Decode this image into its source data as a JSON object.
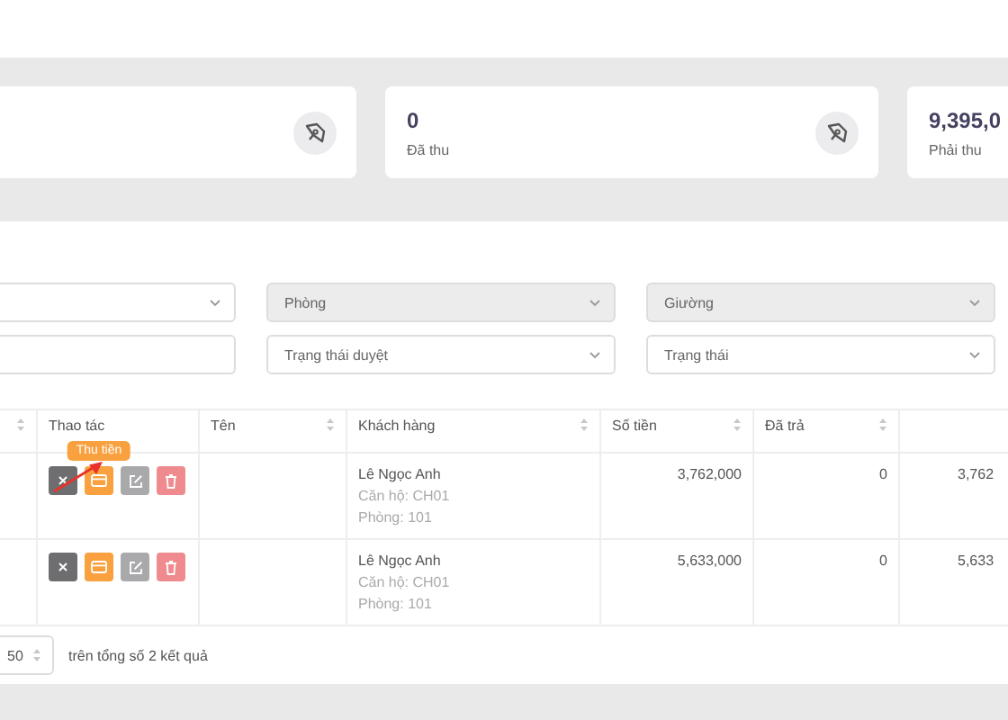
{
  "stats": [
    {
      "icon": true
    },
    {
      "value": "0",
      "label": "Đã thu",
      "icon": true
    },
    {
      "value": "9,395,0",
      "label": "Phải thu",
      "icon": false
    }
  ],
  "filters": [
    {
      "kind": "select",
      "disabled": false
    },
    {
      "kind": "select",
      "placeholder": "Phòng",
      "disabled": true
    },
    {
      "kind": "select",
      "placeholder": "Giường",
      "disabled": true
    },
    {
      "kind": "input",
      "disabled": false
    },
    {
      "kind": "select",
      "placeholder": "Trạng thái duyệt",
      "disabled": false
    },
    {
      "kind": "select",
      "placeholder": "Trạng thái",
      "disabled": false
    }
  ],
  "table": {
    "columns": [
      {
        "kind": "marker",
        "sortable": true
      },
      {
        "kind": "actions",
        "label": "Thao tác",
        "sortable": false
      },
      {
        "kind": "name",
        "label": "Tên",
        "sortable": true
      },
      {
        "kind": "customer",
        "label": "Khách hàng",
        "sortable": true
      },
      {
        "kind": "amount",
        "label": "Số tiền",
        "sortable": true
      },
      {
        "kind": "paid",
        "label": "Đã trả",
        "sortable": true
      },
      {
        "kind": "column_7",
        "sortable": false
      }
    ],
    "rows": [
      {
        "actions": [
          {
            "kind": "cancel"
          },
          {
            "kind": "collect",
            "tooltip": "Thu tiền"
          },
          {
            "kind": "edit"
          },
          {
            "kind": "delete"
          }
        ],
        "customer": {
          "name": "Lê Ngọc Anh",
          "apartment": "Căn hộ: CH01",
          "room": "Phòng: 101"
        },
        "amount": "3,762,000",
        "paid": "0",
        "column_7": "3,762"
      },
      {
        "actions": [
          {
            "kind": "cancel"
          },
          {
            "kind": "collect"
          },
          {
            "kind": "edit"
          },
          {
            "kind": "delete"
          }
        ],
        "customer": {
          "name": "Lê Ngọc Anh",
          "apartment": "Căn hộ: CH01",
          "room": "Phòng: 101"
        },
        "amount": "5,633,000",
        "paid": "0",
        "column_7": "5,633"
      }
    ]
  },
  "annotation_arrow": true,
  "pagination": {
    "page_size": "50",
    "summary": "trên tổng số 2 kết quả"
  }
}
